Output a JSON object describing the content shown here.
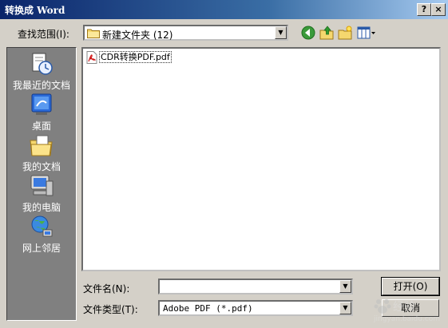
{
  "window": {
    "title": "转换成 Word",
    "help_button": "?",
    "close_button": "×"
  },
  "lookin": {
    "label": "查找范围(I):",
    "value": "新建文件夹 (12)"
  },
  "places": [
    {
      "label": "我最近的文档",
      "icon": "recent-documents-icon"
    },
    {
      "label": "桌面",
      "icon": "desktop-icon"
    },
    {
      "label": "我的文档",
      "icon": "my-documents-icon"
    },
    {
      "label": "我的电脑",
      "icon": "my-computer-icon"
    },
    {
      "label": "网上邻居",
      "icon": "network-places-icon"
    }
  ],
  "files": [
    {
      "name": "CDR转换PDF.pdf",
      "icon": "pdf-file-icon"
    }
  ],
  "filename": {
    "label": "文件名(N):",
    "value": ""
  },
  "filetype": {
    "label": "文件类型(T):",
    "value": "Adobe PDF (*.pdf)"
  },
  "buttons": {
    "open": "打开(O)",
    "cancel": "取消"
  },
  "watermark": {
    "text": "经验",
    "subtext": "jingyan.baidu.com"
  },
  "colors": {
    "titlebar_start": "#0a246a",
    "titlebar_end": "#a6caf0",
    "dialog_bg": "#d4d0c8",
    "places_bg": "#808080"
  }
}
